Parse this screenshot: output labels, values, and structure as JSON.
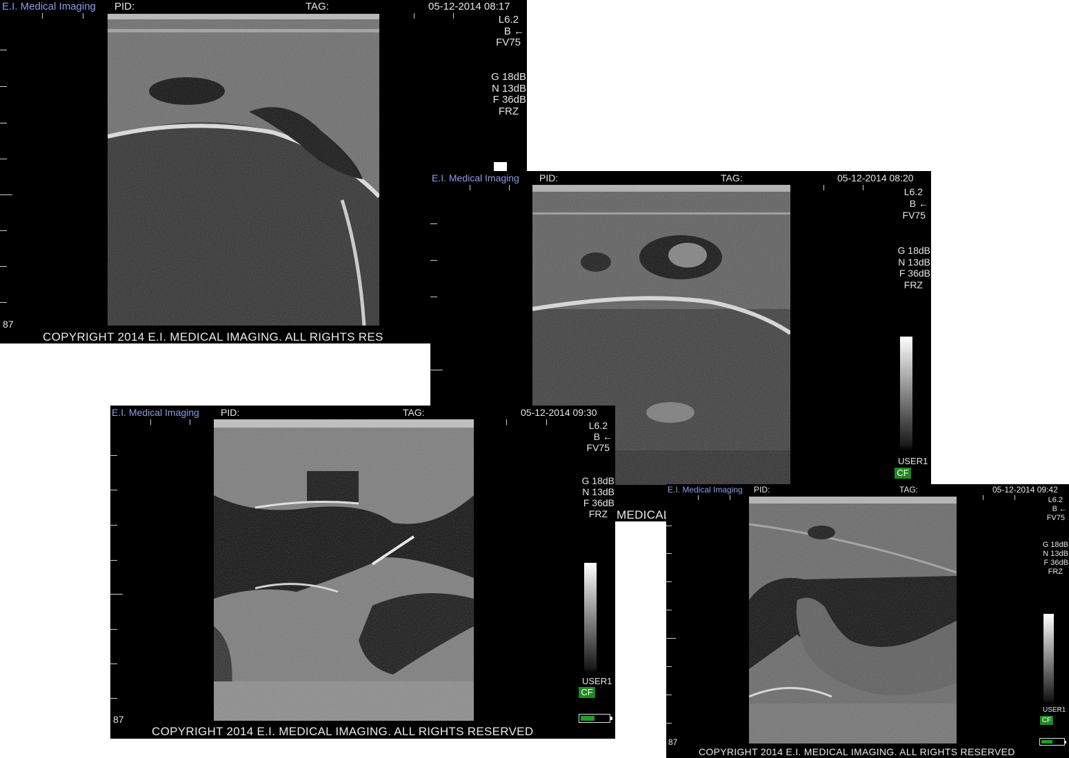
{
  "frames": [
    {
      "brand": "E.I. Medical Imaging",
      "pid_label": "PID:",
      "tag_label": "TAG:",
      "timestamp": "05-12-2014 08:17",
      "probe": "L6.2",
      "mode": "B ←",
      "fv": "FV75",
      "gain": "G 18dB",
      "n": "N 13dB",
      "f": "F 36dB",
      "frz": "FRZ",
      "depth": "87",
      "copyright": "COPYRIGHT 2014 E.I. MEDICAL IMAGING. ALL RIGHTS RES"
    },
    {
      "brand": "E.I. Medical Imaging",
      "pid_label": "PID:",
      "tag_label": "TAG:",
      "timestamp": "05-12-2014 08:20",
      "probe": "L6.2",
      "mode": "B ←",
      "fv": "FV75",
      "gain": "G 18dB",
      "n": "N 13dB",
      "f": "F 36dB",
      "frz": "FRZ",
      "user": "USER1",
      "cf": "CF",
      "copyright_fragment": "MEDICAL"
    },
    {
      "brand": "E.I. Medical Imaging",
      "pid_label": "PID:",
      "tag_label": "TAG:",
      "timestamp": "05-12-2014 09:30",
      "probe": "L6.2",
      "mode": "B ←",
      "fv": "FV75",
      "gain": "G 18dB",
      "n": "N 13dB",
      "f": "F 36dB",
      "frz": "FRZ",
      "user": "USER1",
      "cf": "CF",
      "depth": "87",
      "copyright": "COPYRIGHT 2014 E.I. MEDICAL IMAGING. ALL RIGHTS RESERVED",
      "battery_level": 0.5
    },
    {
      "brand": "E.I. Medical Imaging",
      "pid_label": "PID:",
      "tag_label": "TAG:",
      "timestamp": "05-12-2014 09:42",
      "probe": "L6.2",
      "mode": "B ←",
      "fv": "FV75",
      "gain": "G 18dB",
      "n": "N 13dB",
      "f": "F 36dB",
      "frz": "FRZ",
      "user": "USER1",
      "cf": "CF",
      "depth": "87",
      "copyright": "COPYRIGHT 2014 E.I. MEDICAL IMAGING. ALL RIGHTS RESERVED",
      "battery_level": 0.5
    }
  ]
}
